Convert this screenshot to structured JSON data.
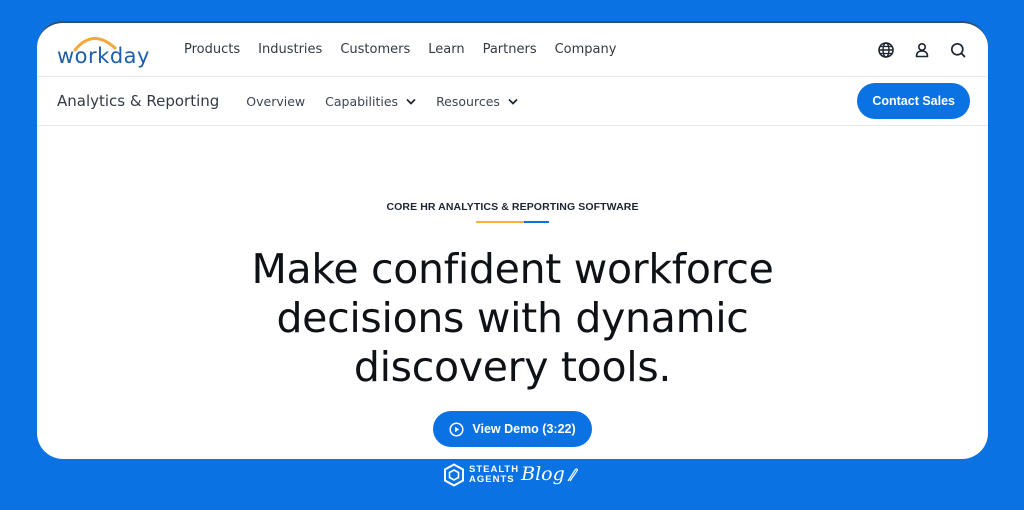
{
  "brand": {
    "logo_text": "workday",
    "logo_arc_color": "#f2a93b",
    "logo_text_color": "#1f5ea8"
  },
  "top_nav": {
    "items": [
      "Products",
      "Industries",
      "Customers",
      "Learn",
      "Partners",
      "Company"
    ],
    "icons": [
      "globe-icon",
      "user-icon",
      "search-icon"
    ]
  },
  "sub_nav": {
    "title": "Analytics & Reporting",
    "items": [
      {
        "label": "Overview",
        "dropdown": false
      },
      {
        "label": "Capabilities",
        "dropdown": true
      },
      {
        "label": "Resources",
        "dropdown": true
      }
    ],
    "cta": "Contact Sales"
  },
  "hero": {
    "eyebrow": "CORE HR ANALYTICS & REPORTING SOFTWARE",
    "headline": "Make confident workforce decisions with dynamic discovery tools.",
    "demo_button": "View Demo (3:22)"
  },
  "footer_brand": {
    "line1": "STEALTH",
    "line2": "AGENTS",
    "script": "Blog"
  },
  "colors": {
    "accent": "#0b72e4",
    "background": "#0b72e4",
    "underline_yellow": "#f2b43c"
  }
}
